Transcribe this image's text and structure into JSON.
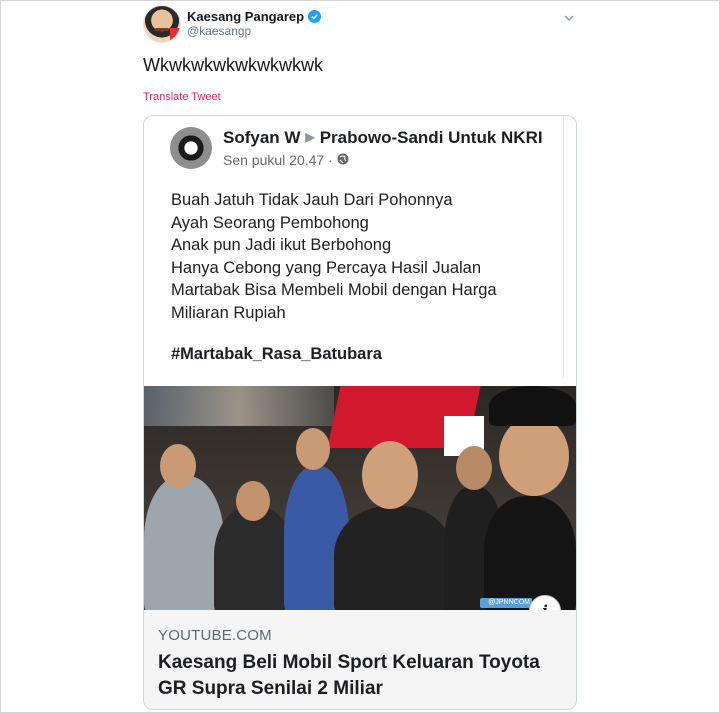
{
  "tweet": {
    "author": {
      "display_name": "Kaesang Pangarep",
      "handle": "@kaesangp",
      "verified": true,
      "avatar_icon": "user-avatar"
    },
    "text": "Wkwkwkwkwkwkwkwk",
    "translate_label": "Translate Tweet"
  },
  "embedded": {
    "fb_post": {
      "poster": "Sofyan W",
      "group": "Prabowo-Sandi Untuk NKRI",
      "time": "Sen pukul 20.47 ·",
      "lines": [
        "Buah Jatuh Tidak Jauh Dari Pohonnya",
        "Ayah Seorang Pembohong",
        "Anak pun Jadi ikut Berbohong",
        "Hanya Cebong yang Percaya Hasil Jualan",
        "Martabak Bisa Membeli Mobil dengan Harga",
        "Miliaran Rupiah"
      ],
      "hashtag": "#Martabak_Rasa_Batubara"
    },
    "link_card": {
      "domain": "YOUTUBE.COM",
      "headline": "Kaesang Beli Mobil Sport Keluaran Toyota GR Supra Senilai 2 Miliar",
      "info_label": "i",
      "watermark": "@JPNNCOM"
    }
  },
  "colors": {
    "verified": "#1da1f2",
    "translate": "#e0245e",
    "muted": "#657786"
  }
}
